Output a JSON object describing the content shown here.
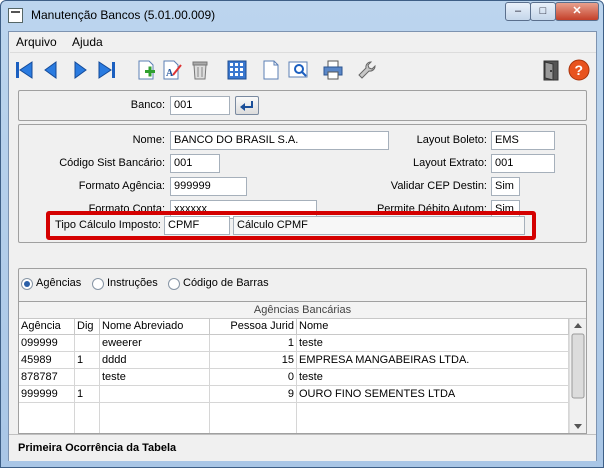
{
  "window": {
    "title": "Manutenção Bancos (5.01.00.009)"
  },
  "window_controls": {
    "minimize": "–",
    "maximize": "□",
    "close": "✕"
  },
  "menu": {
    "items": [
      {
        "label": "Arquivo"
      },
      {
        "label": "Ajuda"
      }
    ]
  },
  "toolbar": {
    "icons": [
      "first-record-icon",
      "previous-record-icon",
      "next-record-icon",
      "last-record-icon",
      "new-document-icon",
      "edit-text-icon",
      "delete-trash-icon",
      "calculator-icon",
      "blank-document-icon",
      "preview-icon",
      "printer-icon",
      "wrench-icon",
      "exit-door-icon",
      "help-icon"
    ]
  },
  "banco": {
    "label": "Banco:",
    "value": "001"
  },
  "form": {
    "nome": {
      "label": "Nome:",
      "value": "BANCO DO BRASIL S.A."
    },
    "codigo_sist": {
      "label": "Código Sist Bancário:",
      "value": "001"
    },
    "formato_agencia": {
      "label": "Formato Agência:",
      "value": "999999"
    },
    "formato_conta": {
      "label": "Formato Conta:",
      "value": "xxxxxx"
    },
    "tipo_calculo": {
      "label": "Tipo Cálculo Imposto:",
      "code": "CPMF",
      "description": "Cálculo CPMF"
    },
    "layout_boleto": {
      "label": "Layout Boleto:",
      "value": "EMS"
    },
    "layout_extrato": {
      "label": "Layout Extrato:",
      "value": "001"
    },
    "validar_cep": {
      "label": "Validar CEP Destin:",
      "value": "Sim"
    },
    "permite_debito": {
      "label": "Permite Débito Autom:",
      "value": "Sim"
    }
  },
  "radios": [
    {
      "label": "Agências",
      "checked": true
    },
    {
      "label": "Instruções",
      "checked": false
    },
    {
      "label": "Código de Barras",
      "checked": false
    }
  ],
  "grid": {
    "title": "Agências Bancárias",
    "columns": [
      "Agência",
      "Dig",
      "Nome Abreviado",
      "Pessoa Jurid",
      "Nome"
    ],
    "rows": [
      [
        "099999",
        "",
        "eweerer",
        "1",
        "teste"
      ],
      [
        "45989",
        "1",
        "dddd",
        "15",
        "EMPRESA MANGABEIRAS LTDA."
      ],
      [
        "878787",
        "",
        "teste",
        "0",
        "teste"
      ],
      [
        "999999",
        "1",
        "",
        "9",
        "OURO FINO SEMENTES LTDA"
      ]
    ]
  },
  "status": {
    "text": "Primeira Ocorrência da Tabela"
  }
}
